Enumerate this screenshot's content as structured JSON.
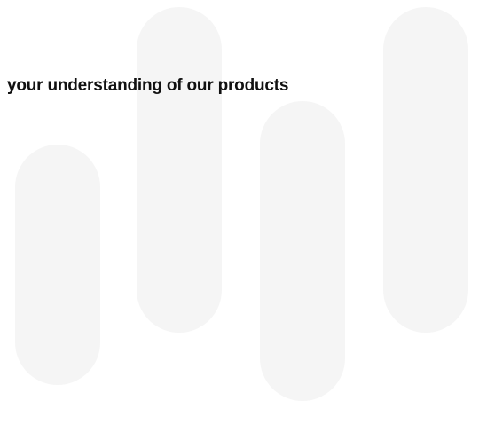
{
  "headline": {
    "text": "your understanding of our products"
  },
  "colors": {
    "background": "#ffffff",
    "pill": "#f5f5f5",
    "text": "#111111"
  }
}
